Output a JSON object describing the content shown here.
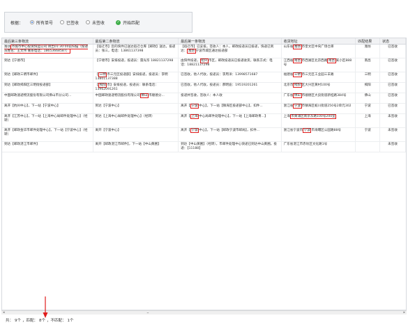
{
  "filter": {
    "label": "根据：",
    "options": [
      "所有单号",
      "已签收",
      "未签收"
    ],
    "selected_index": 0,
    "match_button": "开始匹配"
  },
  "columns": [
    "最后第三条物流",
    "最后第二条物流",
    "最后第一条物流",
    "收货地址",
    "匹配结果",
    "状态"
  ],
  "rows": [
    {
      "c1": [
        "潍坊",
        "市城市中心投资快运公司 转出01:30:00前扫描（投递员姓名：王文伟 联系电话：18653668587）"
      ],
      "c2": [
        "【宿迁市】您的快件已送达宿迁仓库【邮政】送达。投递员：张三，电话：13861137398"
      ],
      "c3": [
        "【宿迁市】已妥投。签收人：本人，邮政投递员已投递，快递已到达：",
        "潍坊",
        "宁波市城区通达投递部"
      ],
      "c4": [
        "山东省",
        "潍坊",
        "市奎文区中央广场仓库"
      ],
      "c5": "潍坊",
      "c6": "已签收"
    },
    {
      "c1": [
        "到达【宁德市】"
      ],
      "c2": [
        "【宁德市】安排投递，投递员：雷光华 18821137298"
      ],
      "c3": [
        "由快件投递，",
        "绍兴",
        "市区，邮政投递员已投递收货，联系方式：电话：18821137298"
      ],
      "c4": [
        "江西省",
        "南昌",
        "市西湖区北京西路",
        "南昌",
        "某小区888号"
      ],
      "c5": "南昌",
      "c6": "已签收"
    },
    {
      "c1": [
        "到达【邮政三明市邮件】"
      ],
      "c2": [
        "【",
        "三明",
        "市三元区投递部】安排投递，投递员：李明 13801137388"
      ],
      "c3": [
        "已签收，他人代收，投递员：李周洋：13998571687"
      ],
      "c4": [
        "福建省",
        "三明",
        "市三元区工业园三羊路"
      ],
      "c5": "三明",
      "c6": "已签收"
    },
    {
      "c1": [
        "到达【邮政揭阳区三明街投递部】"
      ],
      "c2": [
        "【",
        "揭阳",
        "市】安排投递，投递员：联系电话：13962091261"
      ],
      "c3": [
        "已签收，他人代收，投递员：郝明迪：19519201261"
      ],
      "c4": [
        "北京市",
        "揭阳",
        "区大兴区黄村100号"
      ],
      "c5": "揭阳",
      "c6": "已签收"
    },
    {
      "c1": [
        "中国邮政速递物流股份有限公司佛山市分公司..."
      ],
      "c2": [
        "中国邮政速递物流股份有限公司",
        "佛山",
        "市顺德分..."
      ],
      "c3": [
        "投递并签收，签收人：本人收"
      ],
      "c4": [
        "广东省",
        "佛山",
        "市顺德区大良街道新桂路384号"
      ],
      "c5": "佛山",
      "c6": "已签收"
    },
    {
      "c1": [
        "离开【杭州中心】，下一站【宁波中心】"
      ],
      "c2": [
        "到达【宁波中心】"
      ],
      "c3": [
        "离开【",
        "宁波",
        "中心】，下一站【镇海区投递部中心】，扣件..."
      ],
      "c4": [
        "浙江省",
        "宁波",
        "市镇海区蛟川街道250号2单元302"
      ],
      "c5": "宁波",
      "c6": "已签收"
    },
    {
      "c1": [
        "离开【江苏中心】，下一站【上海中心局邮件处理中心】（经转）"
      ],
      "c2": [
        "到达【上海中心局邮件处理中心】（经转）"
      ],
      "c3": [
        "离开【",
        "上海",
        "中心局邮件处理中心】，下一站【上海邮政青...】"
      ],
      "c4": [
        "上海",
        "市黄浦区南京东路100号200室"
      ],
      "c5": "上海",
      "c6": "未签收"
    },
    {
      "c1": [
        "离开【邮政金华市邮件处理中心】，下一站【宁波中心】（经转）"
      ],
      "c2": [
        "离开【宁波中心】"
      ],
      "c3": [
        "离开【",
        "宁波",
        "中心】，下一站【邮政宁波市邮局】，扣件..."
      ],
      "c4": [
        "浙江省宁波市",
        "宁波",
        "市海曙区公园路88号"
      ],
      "c5": "宁波",
      "c6": "未签收"
    },
    {
      "c1": [
        "到达【邮政湛江市邮件】"
      ],
      "c2": [
        "离开【邮政湛江市邮件】，下一站【中山黄圃】"
      ],
      "c3": [
        "到达【中山黄圃】（经转），市邮件处理中心快递已到达中山黄圃。投递：【11188】"
      ],
      "c4": [
        "广东省湛江市赤坎区文化路1号"
      ],
      "c5": "",
      "c6": "未签收"
    }
  ],
  "status_bar": {
    "total_label": "共：",
    "total_value": "9个",
    "matched_label": "，匹配：",
    "matched_value": "8个",
    "unmatched_label": "，不匹配：",
    "unmatched_value": "1个"
  },
  "colors": {
    "highlight": "#e01b1b",
    "accent": "#2c6fd6",
    "go": "#3fae49"
  },
  "icons": {
    "match": "check-circle-icon",
    "pointer": "red-arrow-annotation"
  }
}
